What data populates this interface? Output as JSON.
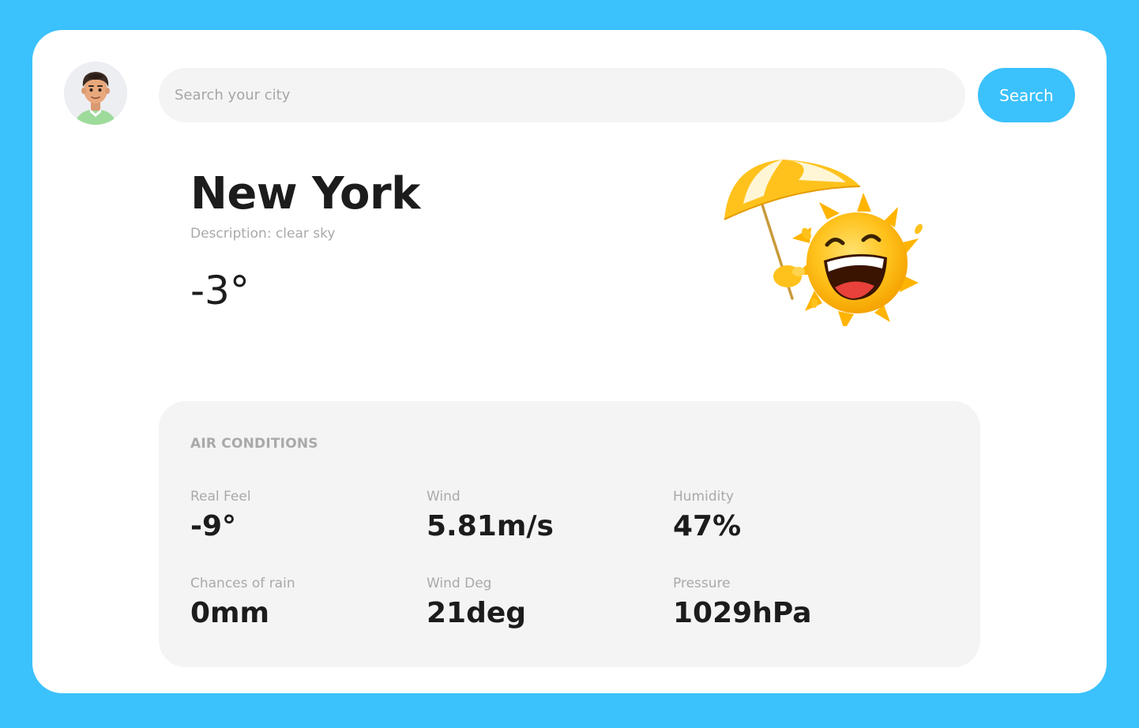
{
  "search": {
    "placeholder": "Search your city",
    "button_label": "Search"
  },
  "weather": {
    "city": "New York",
    "description": "Description: clear sky",
    "temperature": "-3°",
    "illustration_icon": "sun-with-umbrella-icon"
  },
  "air_conditions": {
    "title": "AIR CONDITIONS",
    "metrics": [
      {
        "label": "Real Feel",
        "value": "-9°"
      },
      {
        "label": "Wind",
        "value": "5.81m/s"
      },
      {
        "label": "Humidity",
        "value": "47%"
      },
      {
        "label": "Chances of rain",
        "value": "0mm"
      },
      {
        "label": "Wind Deg",
        "value": "21deg"
      },
      {
        "label": "Pressure",
        "value": "1029hPa"
      }
    ]
  },
  "colors": {
    "background": "#3bc1fc",
    "accent": "#3bc1fc",
    "card": "#ffffff",
    "panel": "#f4f4f4",
    "muted_text": "#a9a9a9",
    "primary_text": "#1c1c1c"
  }
}
